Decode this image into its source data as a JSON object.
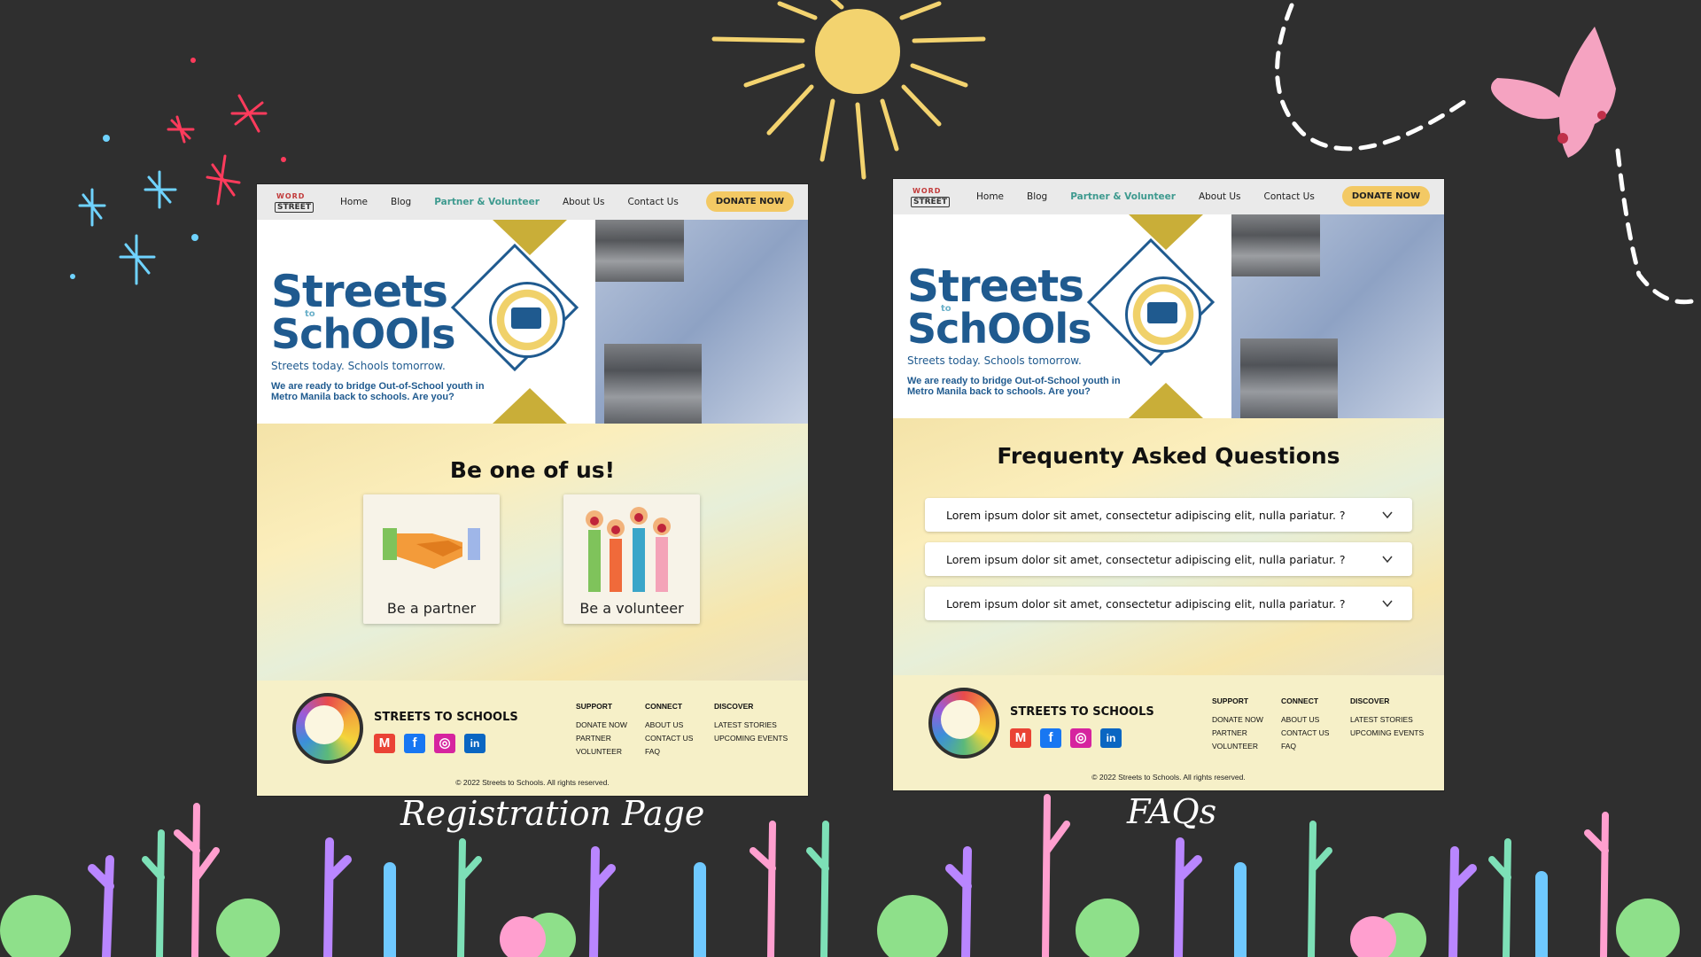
{
  "captions": {
    "left": "Registration Page",
    "right": "FAQs"
  },
  "site": {
    "logo_line1": "WORD",
    "logo_line2": "STREET",
    "nav": [
      "Home",
      "Blog",
      "Partner & Volunteer",
      "About Us",
      "Contact Us"
    ],
    "nav_active": "Partner & Volunteer",
    "donate": "DONATE NOW",
    "brand_line1": "Streets",
    "brand_line2": "to",
    "brand_line3": "SchOOls",
    "tagline": "Streets today. Schools tomorrow.",
    "mission": "We are ready to bridge Out-of-School youth in Metro Manila back to schools. Are you?"
  },
  "registration": {
    "heading": "Be one of us!",
    "cards": [
      {
        "label": "Be a partner",
        "icon": "handshake-icon"
      },
      {
        "label": "Be a volunteer",
        "icon": "raised-hands-icon"
      }
    ]
  },
  "faqs": {
    "heading": "Frequenty Asked Questions",
    "items": [
      "Lorem ipsum dolor sit amet, consectetur adipiscing elit, nulla pariatur. ?",
      "Lorem ipsum dolor sit amet, consectetur adipiscing elit, nulla pariatur. ?",
      "Lorem ipsum dolor sit amet, consectetur adipiscing elit, nulla pariatur. ?"
    ]
  },
  "footer": {
    "name": "STREETS TO SCHOOLS",
    "social": [
      "gmail-icon",
      "facebook-icon",
      "instagram-icon",
      "linkedin-icon"
    ],
    "columns": [
      {
        "heading": "SUPPORT",
        "links": [
          "DONATE NOW",
          "PARTNER",
          "VOLUNTEER"
        ]
      },
      {
        "heading": "CONNECT",
        "links": [
          "ABOUT US",
          "CONTACT US",
          "FAQ"
        ]
      },
      {
        "heading": "DISCOVER",
        "links": [
          "LATEST STORIES",
          "UPCOMING EVENTS"
        ]
      }
    ],
    "copyright": "© 2022 Streets to Schools. All rights reserved."
  },
  "colors": {
    "background": "#2f2f2f",
    "brand_blue": "#1f5a8f",
    "accent_teal": "#3e9a8f",
    "donate_yellow": "#f3c964",
    "gold": "#c9ae38",
    "footer_bg": "#f6f0c8"
  }
}
